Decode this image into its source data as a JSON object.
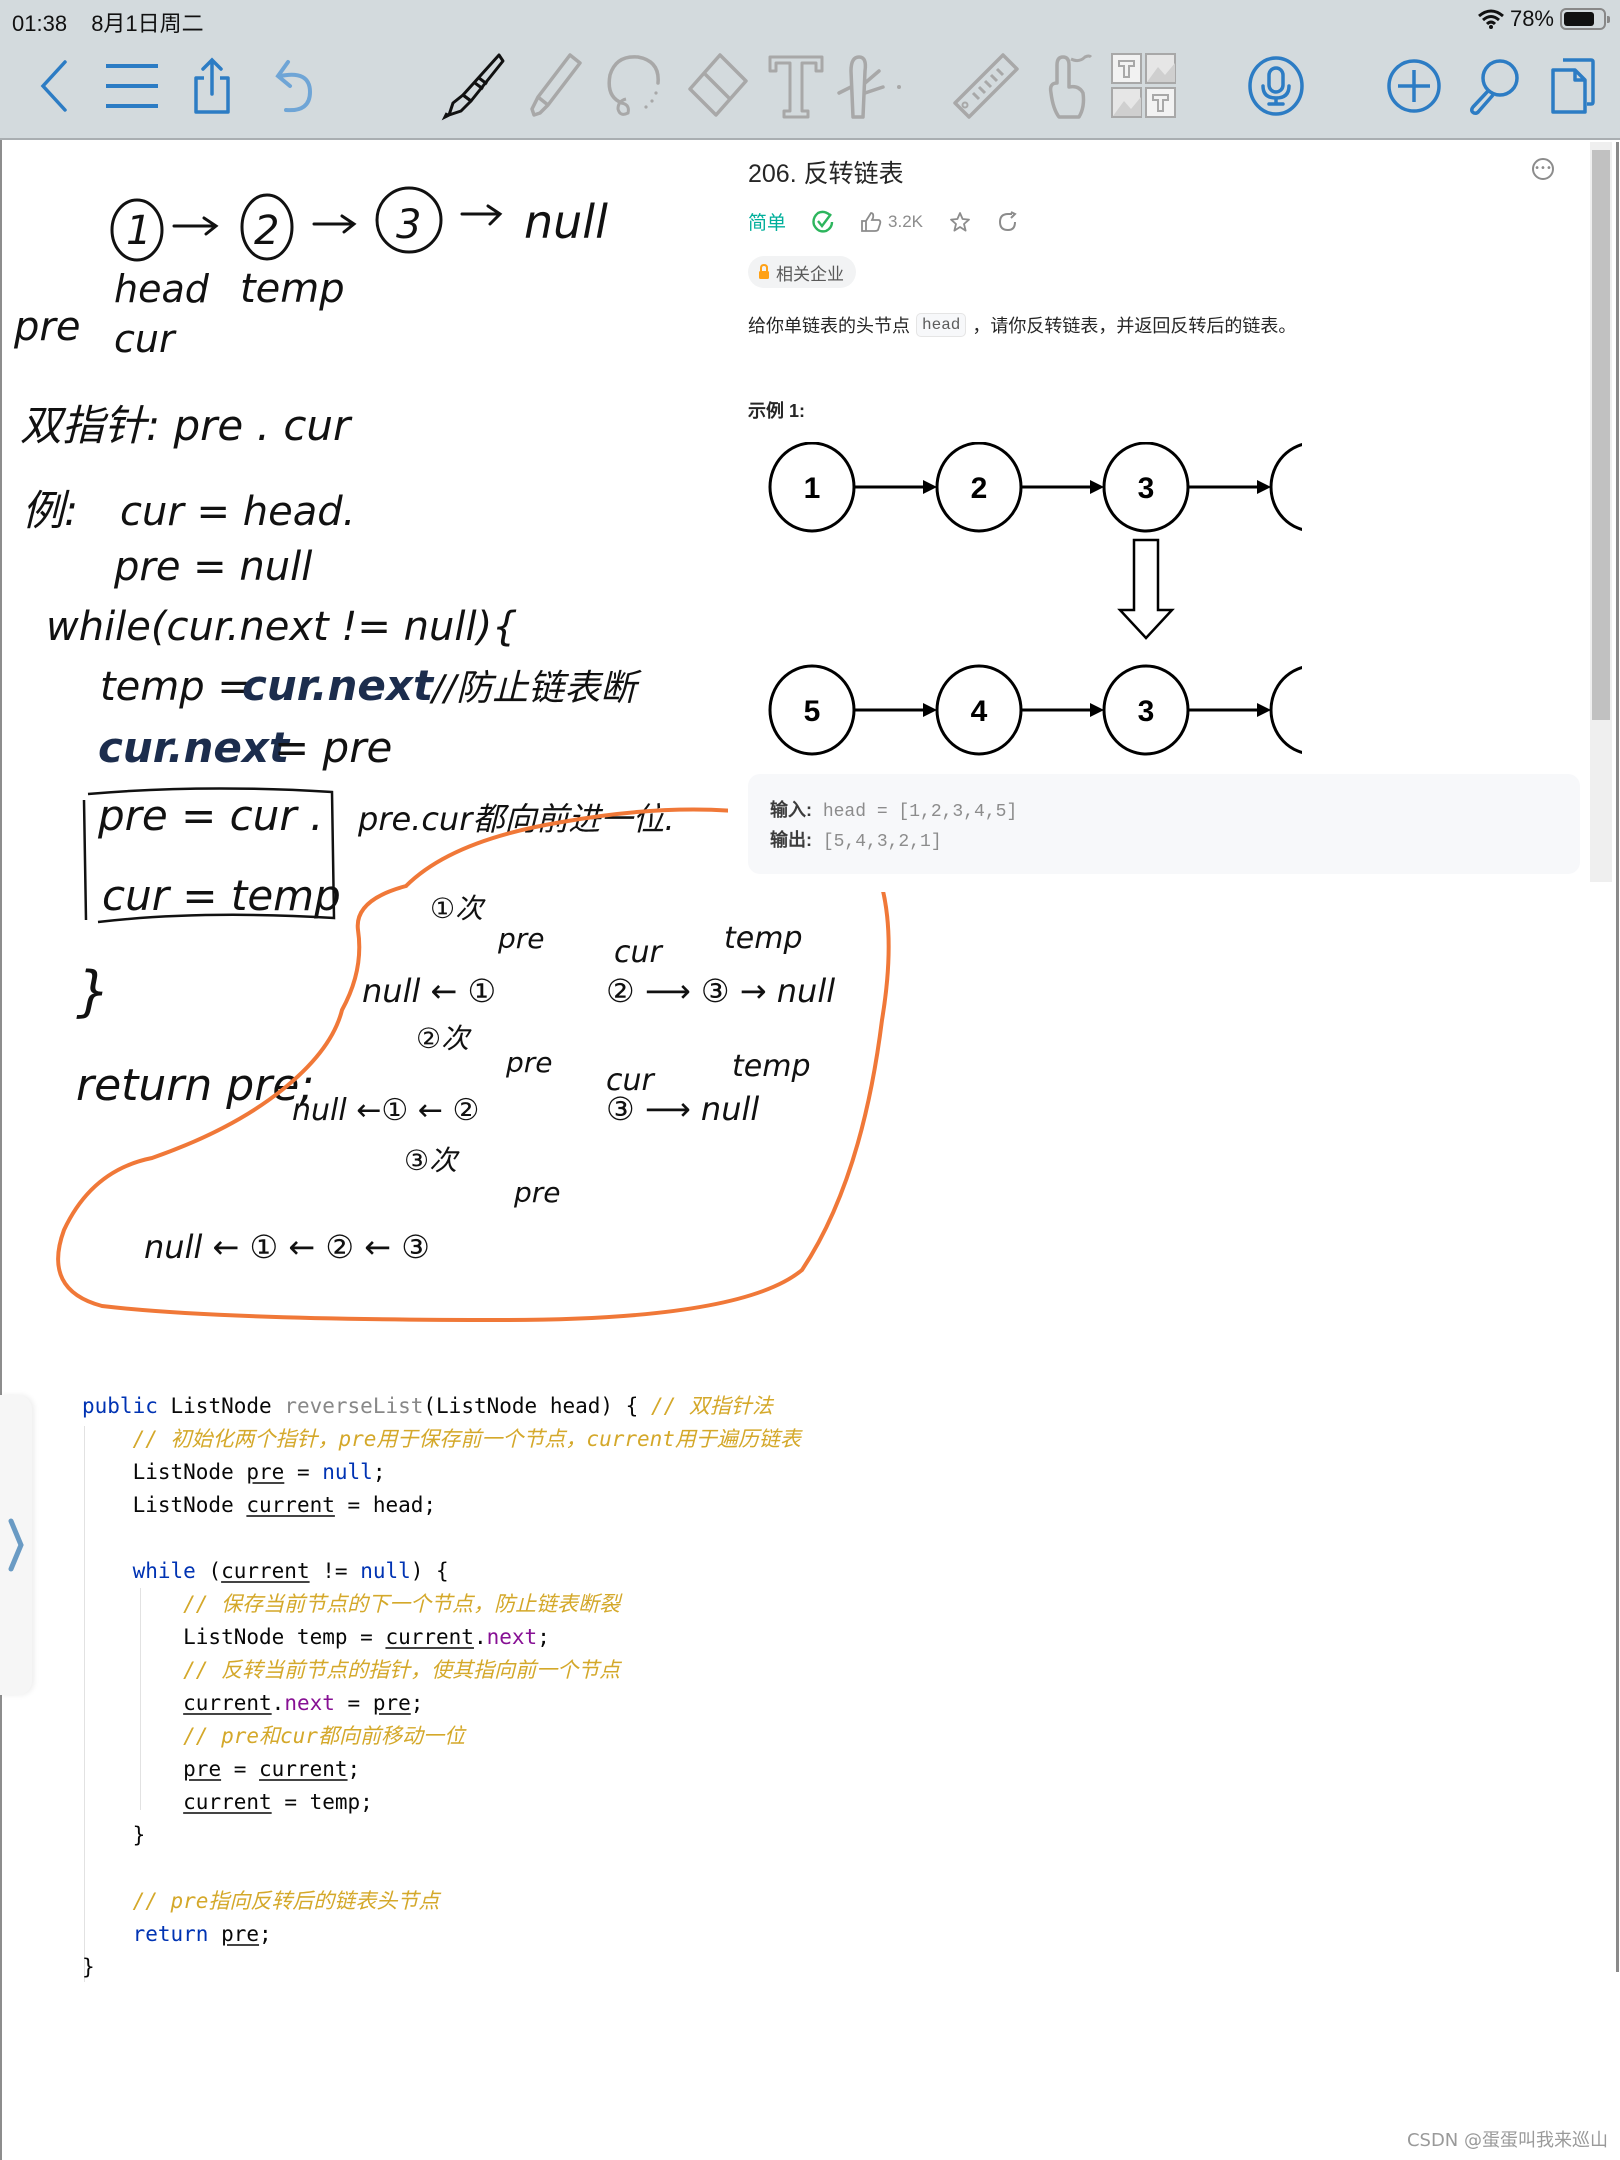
{
  "status_bar": {
    "time": "01:38",
    "date": "8月1日周二",
    "battery_percent": "78%",
    "battery_level": 0.78
  },
  "toolbar": {
    "left_icons": [
      "back-icon",
      "menu-icon",
      "share-icon",
      "undo-icon"
    ],
    "tools": [
      "pen-icon",
      "highlighter-icon",
      "lasso-icon",
      "eraser-icon",
      "text-icon",
      "multitool-icon",
      "ruler-icon",
      "gesture-icon",
      "layout-icon"
    ],
    "active_tool": "pen-icon",
    "right_icons": [
      "microphone-icon",
      "add-icon",
      "search-icon",
      "pages-icon"
    ]
  },
  "problem": {
    "title": "206. 反转链表",
    "difficulty": "简单",
    "likes": "3.2K",
    "company_tag": "相关企业",
    "description_before": "给你单链表的头节点",
    "description_code": "head",
    "description_after": "，请你反转链表，并返回反转后的链表。",
    "example_title": "示例 1:",
    "input_list": [
      "1",
      "2",
      "3",
      "4",
      "5"
    ],
    "output_list": [
      "5",
      "4",
      "3",
      "2",
      "1"
    ],
    "io": {
      "input_label": "输入:",
      "input_value": "head = [1,2,3,4,5]",
      "output_label": "输出:",
      "output_value": "[5,4,3,2,1]"
    }
  },
  "handwriting": {
    "list_nodes": [
      "1",
      "2",
      "3"
    ],
    "list_end": "null",
    "label_head": "head",
    "label_cur": "cur",
    "label_temp": "temp",
    "label_pre": "pre",
    "two_pointer": "双指针: pre . cur",
    "example_label": "例:",
    "init_cur": "cur = head.",
    "init_pre": "pre = null",
    "while_line": "while(cur.next != null){",
    "temp_line_a": "temp = ",
    "temp_line_b": "cur.next",
    "temp_comment": "//防止链表断",
    "cur_next_a": "cur.next",
    "cur_next_b": "= pre",
    "pre_cur": "pre = cur .",
    "cur_temp": "cur = temp",
    "advance_note": "pre.cur都向前进一位.",
    "close_brace": "}",
    "return_line": "return  pre;",
    "iterations": [
      {
        "label": "①次",
        "left": "null ← ①",
        "left_tag": "pre",
        "right": "② ⟶ ③ → null",
        "cur_tag": "cur",
        "temp_tag": "temp"
      },
      {
        "label": "②次",
        "left": "null ←① ← ②",
        "left_tag": "pre",
        "right": "③ ⟶ null",
        "cur_tag": "cur",
        "temp_tag": "temp"
      },
      {
        "label": "③次",
        "left": "null ← ① ← ② ← ③",
        "left_tag": "pre"
      }
    ]
  },
  "code": {
    "lines": [
      [
        [
          "kw",
          "public "
        ],
        [
          "",
          "ListNode "
        ],
        [
          "fn",
          "reverseList"
        ],
        [
          "",
          "(ListNode head) { "
        ],
        [
          "cm",
          "// 双指针法"
        ]
      ],
      [
        [
          "",
          "    "
        ],
        [
          "cm",
          "// 初始化两个指针，pre用于保存前一个节点，current用于遍历链表"
        ]
      ],
      [
        [
          "",
          "    ListNode "
        ],
        [
          "var",
          "pre"
        ],
        [
          "",
          " = "
        ],
        [
          "kw",
          "null"
        ],
        [
          "",
          ";"
        ]
      ],
      [
        [
          "",
          "    ListNode "
        ],
        [
          "var",
          "current"
        ],
        [
          "",
          "",
          " = head;"
        ],
        [
          "",
          " = head;"
        ]
      ],
      [
        [
          "",
          ""
        ]
      ],
      [
        [
          "",
          "    "
        ],
        [
          "kw",
          "while "
        ],
        [
          "",
          "("
        ],
        [
          "var",
          "current"
        ],
        [
          "",
          " != "
        ],
        [
          "kw",
          "null"
        ],
        [
          "",
          ") {"
        ]
      ],
      [
        [
          "",
          "        "
        ],
        [
          "cm",
          "// 保存当前节点的下一个节点，防止链表断裂"
        ]
      ],
      [
        [
          "",
          "        ListNode temp = "
        ],
        [
          "var",
          "current"
        ],
        [
          "",
          "."
        ],
        [
          "fld",
          "next"
        ],
        [
          "",
          ";"
        ]
      ],
      [
        [
          "",
          "        "
        ],
        [
          "cm",
          "// 反转当前节点的指针，使其指向前一个节点"
        ]
      ],
      [
        [
          "",
          "        "
        ],
        [
          "var",
          "current"
        ],
        [
          "",
          "."
        ],
        [
          "fld",
          "next"
        ],
        [
          "",
          " = "
        ],
        [
          "var",
          "pre"
        ],
        [
          "",
          ";"
        ]
      ],
      [
        [
          "",
          "        "
        ],
        [
          "cm",
          "// pre和cur都向前移动一位"
        ]
      ],
      [
        [
          "",
          "        "
        ],
        [
          "var",
          "pre"
        ],
        [
          "",
          " = "
        ],
        [
          "var",
          "current"
        ],
        [
          "",
          ";"
        ]
      ],
      [
        [
          "",
          "        "
        ],
        [
          "var",
          "current"
        ],
        [
          "",
          " = temp;"
        ]
      ],
      [
        [
          "",
          "    }"
        ]
      ],
      [
        [
          "",
          ""
        ]
      ],
      [
        [
          "",
          "    "
        ],
        [
          "cm",
          "// pre指向反转后的链表头节点"
        ]
      ],
      [
        [
          "",
          "    "
        ],
        [
          "kw",
          "return "
        ],
        [
          "var",
          "pre"
        ],
        [
          "",
          ";"
        ]
      ],
      [
        [
          "",
          "}"
        ]
      ]
    ]
  },
  "watermark": "CSDN @蛋蛋叫我来巡山",
  "colors": {
    "toolbar_blue": "#2c7cc4",
    "tool_gray": "#a9a9a9",
    "lasso_orange": "#f07838",
    "ink_black": "#111111",
    "ink_navy": "#1c2d4d",
    "difficulty_green": "#00af9b"
  }
}
